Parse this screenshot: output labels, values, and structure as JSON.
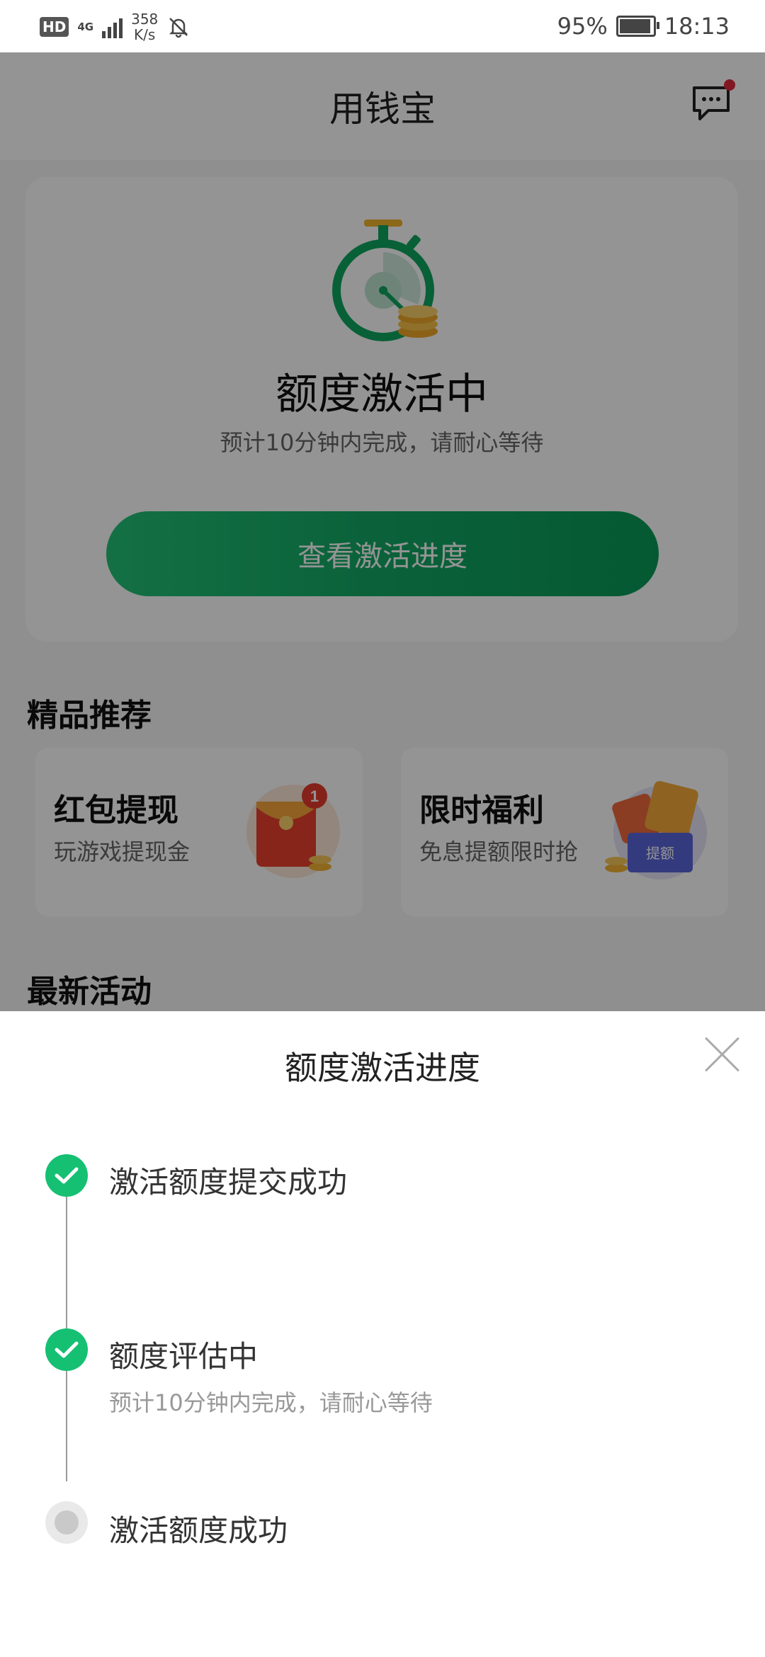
{
  "status_bar": {
    "hd": "HD",
    "network_gen": "4G",
    "speed_value": "358",
    "speed_unit": "K/s",
    "battery": "95%",
    "battery_level": 0.95,
    "time": "18:13"
  },
  "header": {
    "title": "用钱宝"
  },
  "activation_card": {
    "status_title": "额度激活中",
    "status_subtitle": "预计10分钟内完成，请耐心等待",
    "button_label": "查看激活进度"
  },
  "featured": {
    "section_title": "精品推荐",
    "items": [
      {
        "title": "红包提现",
        "subtitle": "玩游戏提现金",
        "badge": "1"
      },
      {
        "title": "限时福利",
        "subtitle": "免息提额限时抢",
        "tag": "提额"
      }
    ]
  },
  "latest": {
    "section_title": "最新活动"
  },
  "progress_sheet": {
    "title": "额度激活进度",
    "steps": [
      {
        "label": "激活额度提交成功",
        "state": "done"
      },
      {
        "label": "额度评估中",
        "note": "预计10分钟内完成，请耐心等待",
        "state": "done"
      },
      {
        "label": "激活额度成功",
        "state": "pending"
      }
    ]
  },
  "colors": {
    "accent_green": "#15c073",
    "button_green": "#12a864",
    "notify_red": "#e0283a"
  },
  "icons": [
    "message-icon",
    "bell-off-icon",
    "stopwatch-icon",
    "check-icon",
    "close-icon"
  ]
}
